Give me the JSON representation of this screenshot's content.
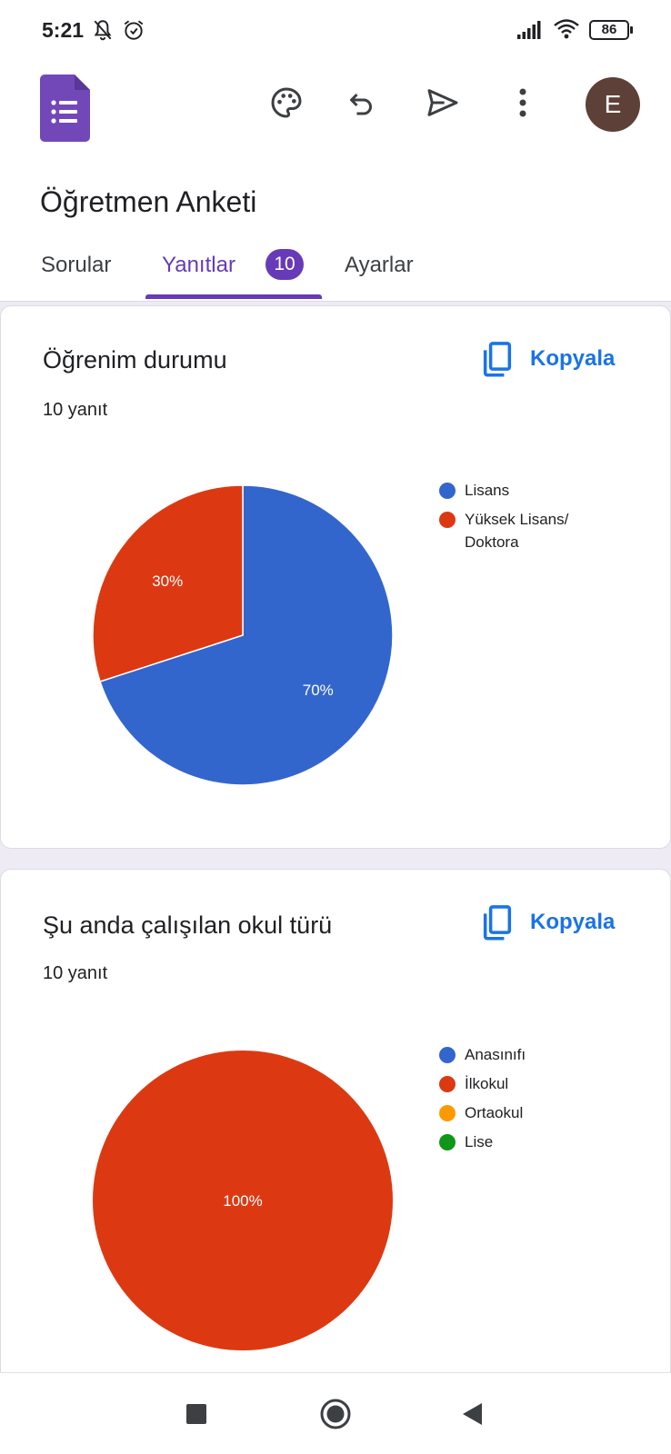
{
  "status_bar": {
    "time": "5:21",
    "icons": [
      "notifications-off-icon",
      "alarm-icon",
      "signal-icon",
      "wifi-icon"
    ],
    "battery": "86"
  },
  "header": {
    "logo": "google-forms-logo",
    "actions": [
      {
        "icon": "palette-icon"
      },
      {
        "icon": "undo-icon"
      },
      {
        "icon": "send-icon"
      },
      {
        "icon": "more-vert-icon"
      }
    ],
    "avatar_letter": "E",
    "form_title": "Öğretmen Anketi",
    "tabs": [
      {
        "label": "Sorular",
        "active": false
      },
      {
        "label": "Yanıtlar",
        "active": true,
        "badge": "10"
      },
      {
        "label": "Ayarlar",
        "active": false
      }
    ]
  },
  "questions": [
    {
      "title": "Öğrenim durumu",
      "response_count": "10 yanıt",
      "copy_label": "Kopyala",
      "chart_data": {
        "type": "pie",
        "categories": [
          "Lisans",
          "Yüksek Lisans/ Doktora"
        ],
        "values": [
          70,
          30
        ],
        "labels": [
          "70%",
          "30%"
        ],
        "colors": [
          "#3366cc",
          "#dc3912"
        ],
        "legend_position": "right"
      }
    },
    {
      "title": "Şu anda çalışılan okul türü",
      "response_count": "10 yanıt",
      "copy_label": "Kopyala",
      "chart_data": {
        "type": "pie",
        "categories": [
          "Anasınıfı",
          "İlkokul",
          "Ortaokul",
          "Lise"
        ],
        "values": [
          0,
          100,
          0,
          0
        ],
        "labels": [
          "",
          "100%",
          "",
          ""
        ],
        "colors": [
          "#3366cc",
          "#dc3912",
          "#ff9900",
          "#109618"
        ],
        "legend_position": "right"
      }
    }
  ],
  "nav_bar": {
    "buttons": [
      "recents-square-icon",
      "home-circle-icon",
      "back-triangle-icon"
    ]
  }
}
